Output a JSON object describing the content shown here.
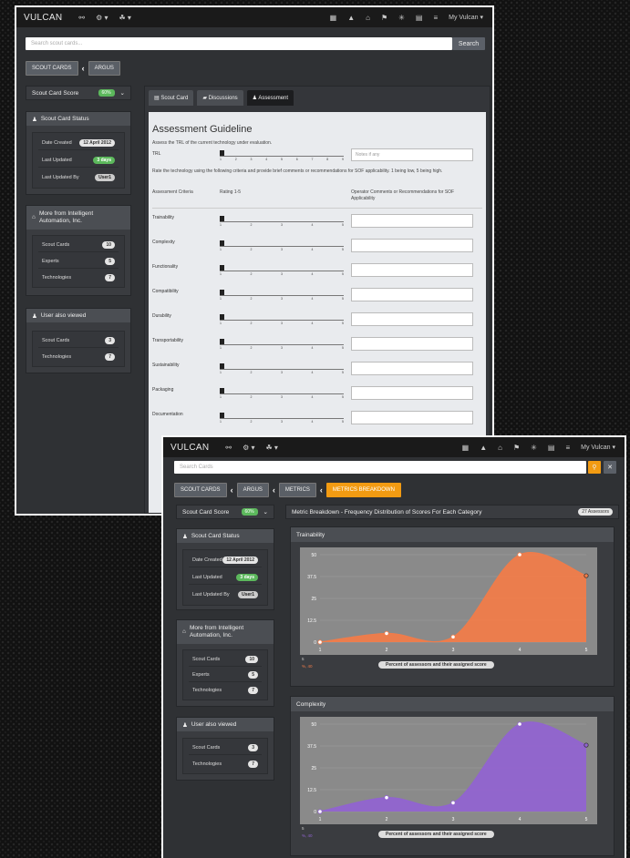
{
  "window1": {
    "nav": {
      "brand": "VULCAN",
      "user": "My Vulcan ▾",
      "left_icons": [
        "⚯",
        "⚙ ▾",
        "☘ ▾"
      ],
      "right_icons": [
        "▦",
        "▲",
        "⌂",
        "⚑",
        "✳",
        "▤",
        "≡"
      ]
    },
    "search": {
      "placeholder": "Search scout cards...",
      "button": "Search"
    },
    "breadcrumb": [
      "SCOUT CARDS",
      "ARGUS"
    ],
    "scorecard": {
      "label": "Scout Card Score",
      "badge": "60%"
    },
    "status": {
      "title": "Scout Card Status",
      "rows": [
        {
          "label": "Date Created",
          "value": "12 April 2012"
        },
        {
          "label": "Last Updated",
          "value": "3 days"
        },
        {
          "label": "Last Updated By",
          "value": "User1"
        }
      ]
    },
    "more": {
      "title": "More from Intelligent Automation, Inc.",
      "rows": [
        {
          "label": "Scout Cards",
          "value": "10"
        },
        {
          "label": "Experts",
          "value": "5"
        },
        {
          "label": "Technologies",
          "value": "7"
        }
      ]
    },
    "also": {
      "title": "User also viewed",
      "rows": [
        {
          "label": "Scout Cards",
          "value": "3"
        },
        {
          "label": "Technologies",
          "value": "7"
        }
      ]
    },
    "tabs": [
      "Scout Card",
      "Discussions",
      "Assessment"
    ],
    "assessment": {
      "title": "Assessment Guideline",
      "trl_instruction": "Assess the TRL of the current technology under evaluation.",
      "trl_label": "TRL",
      "trl_notes_placeholder": "Notes if any",
      "rate_instruction": "Rate the technology using the following criteria and provide brief comments or recommendations for SOF applicability. 1 being low, 5 being high.",
      "col_criteria": "Assessment Criteria",
      "col_rating": "Rating 1-5",
      "col_comments": "Operator Comments or Recommendations for SOF Applicability",
      "criteria": [
        "Trainability",
        "Complexity",
        "Functionality",
        "Compatibility",
        "Durability",
        "Transportability",
        "Sustainability",
        "Packaging",
        "Documentation"
      ],
      "trl_ticks": [
        "1",
        "2",
        "3",
        "4",
        "5",
        "6",
        "7",
        "8",
        "9"
      ],
      "rating_ticks": [
        "1",
        "2",
        "3",
        "4",
        "5"
      ]
    }
  },
  "window2": {
    "nav": {
      "brand": "VULCAN",
      "user": "My Vulcan ▾",
      "left_icons": [
        "⚯",
        "⚙ ▾",
        "☘ ▾"
      ],
      "right_icons": [
        "▦",
        "▲",
        "⌂",
        "⚑",
        "✳",
        "▤",
        "≡"
      ]
    },
    "search": {
      "placeholder": "Search Cards"
    },
    "breadcrumb": [
      "SCOUT CARDS",
      "ARGUS",
      "METRICS",
      "METRICS BREAKDOWN"
    ],
    "scorecard": {
      "label": "Scout Card Score",
      "badge": "60%"
    },
    "status": {
      "title": "Scout Card Status",
      "rows": [
        {
          "label": "Date Created",
          "value": "12 April 2012"
        },
        {
          "label": "Last Updated",
          "value": "3 days"
        },
        {
          "label": "Last Updated By",
          "value": "User1"
        }
      ]
    },
    "more": {
      "title": "More from Intelligent Automation, Inc.",
      "rows": [
        {
          "label": "Scout Cards",
          "value": "10"
        },
        {
          "label": "Experts",
          "value": "5"
        },
        {
          "label": "Technologies",
          "value": "7"
        }
      ]
    },
    "also": {
      "title": "User also viewed",
      "rows": [
        {
          "label": "Scout Cards",
          "value": "3"
        },
        {
          "label": "Technologies",
          "value": "7"
        }
      ]
    },
    "breakdown": {
      "title": "Metric Breakdown - Frequency Distribution of Scores For Each Category",
      "count": "27 Assessors"
    }
  },
  "chart_data": [
    {
      "type": "area",
      "title": "Trainability",
      "x": [
        1,
        2,
        3,
        4,
        5
      ],
      "values": [
        0,
        5,
        3,
        50,
        38
      ],
      "yticks": [
        0,
        12.5,
        25,
        37.5,
        50
      ],
      "ylim": [
        0,
        50
      ],
      "xlabel": "Percent of assessors and their assigned score",
      "color": "#f07c4a",
      "legend_value": "5",
      "legend_series": "%, 40"
    },
    {
      "type": "area",
      "title": "Complexity",
      "x": [
        1,
        2,
        3,
        4,
        5
      ],
      "values": [
        0,
        8,
        5,
        50,
        38
      ],
      "yticks": [
        0,
        12.5,
        25,
        37.5,
        50
      ],
      "ylim": [
        0,
        50
      ],
      "xlabel": "Percent of assessors and their assigned score",
      "color": "#9164d0",
      "legend_value": "5",
      "legend_series": "%, 40"
    }
  ]
}
